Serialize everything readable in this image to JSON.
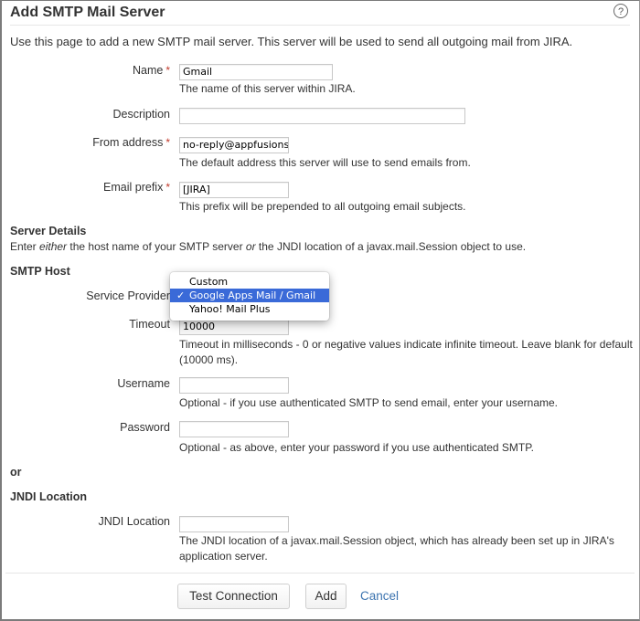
{
  "page": {
    "title": "Add SMTP Mail Server",
    "help_icon": "help-icon",
    "intro": "Use this page to add a new SMTP mail server. This server will be used to send all outgoing mail from JIRA."
  },
  "fields": {
    "name": {
      "label": "Name",
      "required": "*",
      "value": "Gmail",
      "description": "The name of this server within JIRA."
    },
    "description": {
      "label": "Description",
      "value": ""
    },
    "from_address": {
      "label": "From address",
      "required": "*",
      "value": "no-reply@appfusions.",
      "description": "The default address this server will use to send emails from."
    },
    "email_prefix": {
      "label": "Email prefix",
      "required": "*",
      "value": "[JIRA]",
      "description": "This prefix will be prepended to all outgoing email subjects."
    }
  },
  "server_details": {
    "heading": "Server Details",
    "text_pre": "Enter ",
    "text_em1": "either",
    "text_mid": " the host name of your SMTP server ",
    "text_em2": "or",
    "text_post": " the JNDI location of a javax.mail.Session object to use."
  },
  "smtp_host": {
    "heading": "SMTP Host",
    "service_provider": {
      "label": "Service Provider",
      "options": [
        "Custom",
        "Google Apps Mail / Gmail",
        "Yahoo! Mail Plus"
      ],
      "selected": "Google Apps Mail / Gmail",
      "check_glyph": "✓"
    },
    "timeout": {
      "label": "Timeout",
      "value": "10000",
      "description_line1": "Timeout in milliseconds - 0 or negative values indicate infinite timeout. Leave blank for default",
      "description_line2": "(10000 ms)."
    },
    "username": {
      "label": "Username",
      "value": "",
      "description": "Optional - if you use authenticated SMTP to send email, enter your username."
    },
    "password": {
      "label": "Password",
      "value": "",
      "description": "Optional - as above, enter your password if you use authenticated SMTP."
    }
  },
  "or_label": "or",
  "jndi": {
    "heading": "JNDI Location",
    "label": "JNDI Location",
    "value": "",
    "description_line1": "The JNDI location of a javax.mail.Session object, which has already been set up in JIRA's",
    "description_line2": "application server."
  },
  "buttons": {
    "test_connection": "Test Connection",
    "add": "Add",
    "cancel": "Cancel"
  },
  "colors": {
    "link": "#3b73af",
    "required": "#c0392b",
    "selection": "#3a6ad8"
  }
}
